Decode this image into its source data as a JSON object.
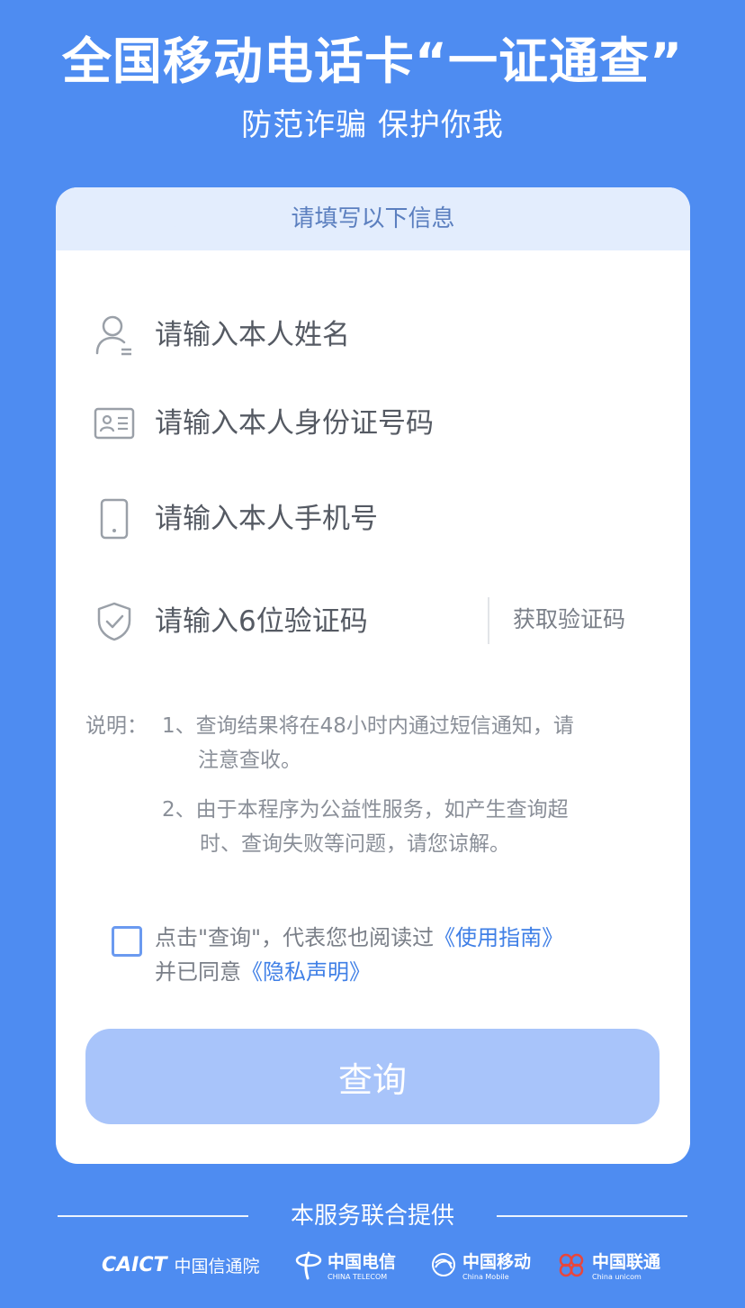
{
  "header": {
    "title": "全国移动电话卡“一证通查”",
    "subtitle": "防范诈骗 保护你我"
  },
  "form": {
    "section_label": "请填写以下信息",
    "name_placeholder": "请输入本人姓名",
    "id_placeholder": "请输入本人身份证号码",
    "phone_placeholder": "请输入本人手机号",
    "code_placeholder": "请输入6位验证码",
    "get_code_label": "获取验证码"
  },
  "notes": {
    "label": "说明：",
    "item1_line1": "1、查询结果将在48小时内通过短信通知，请",
    "item1_line2": "注意查收。",
    "item2_line1": "2、由于本程序为公益性服务，如产生查询超",
    "item2_line2": "时、查询失败等问题，请您谅解。"
  },
  "agreement": {
    "text1": "点击\"查询\"，代表您也阅读过",
    "link1": "《使用指南》",
    "text2": "并已同意",
    "link2": "《隐私声明》"
  },
  "submit_label": "查询",
  "footer": {
    "provided_by": "本服务联合提供",
    "logos": {
      "caict_mark": "CAICT",
      "caict_name": "中国信通院",
      "telecom_name": "中国电信",
      "telecom_sub": "CHINA TELECOM",
      "mobile_name": "中国移动",
      "mobile_sub": "China Mobile",
      "unicom_name": "中国联通",
      "unicom_sub": "China unicom"
    }
  },
  "colors": {
    "background": "#4e8cf1",
    "card": "#ffffff",
    "tab": "#e3edfd",
    "link": "#3f7fe6",
    "button": "#a8c4fa"
  }
}
